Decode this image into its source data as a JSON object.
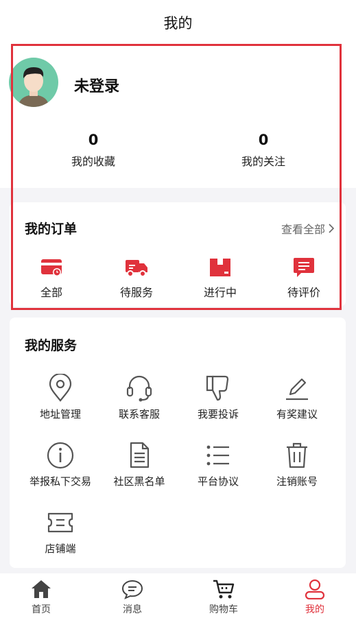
{
  "header": {
    "title": "我的"
  },
  "profile": {
    "name": "未登录"
  },
  "stats": [
    {
      "value": "0",
      "label": "我的收藏"
    },
    {
      "value": "0",
      "label": "我的关注"
    }
  ],
  "orders": {
    "title": "我的订单",
    "view_all": "查看全部",
    "items": [
      {
        "label": "全部",
        "icon": "wallet-card-icon"
      },
      {
        "label": "待服务",
        "icon": "delivery-truck-icon"
      },
      {
        "label": "进行中",
        "icon": "package-box-icon"
      },
      {
        "label": "待评价",
        "icon": "comment-bubble-icon"
      }
    ]
  },
  "services": {
    "title": "我的服务",
    "items": [
      {
        "label": "地址管理",
        "icon": "location-pin-icon"
      },
      {
        "label": "联系客服",
        "icon": "headset-icon"
      },
      {
        "label": "我要投诉",
        "icon": "thumbs-down-icon"
      },
      {
        "label": "有奖建议",
        "icon": "pencil-icon"
      },
      {
        "label": "举报私下交易",
        "icon": "info-circle-icon"
      },
      {
        "label": "社区黑名单",
        "icon": "document-icon"
      },
      {
        "label": "平台协议",
        "icon": "list-icon"
      },
      {
        "label": "注销账号",
        "icon": "trash-icon"
      },
      {
        "label": "店铺端",
        "icon": "ticket-icon"
      }
    ]
  },
  "tabbar": {
    "active": "我的",
    "items": [
      {
        "label": "首页",
        "icon": "home-icon"
      },
      {
        "label": "消息",
        "icon": "chat-icon"
      },
      {
        "label": "购物车",
        "icon": "cart-icon"
      },
      {
        "label": "我的",
        "icon": "user-icon"
      }
    ]
  },
  "colors": {
    "accent": "#e0323c",
    "icon_gray": "#555555",
    "avatar_bg": "#6fcaa8"
  }
}
